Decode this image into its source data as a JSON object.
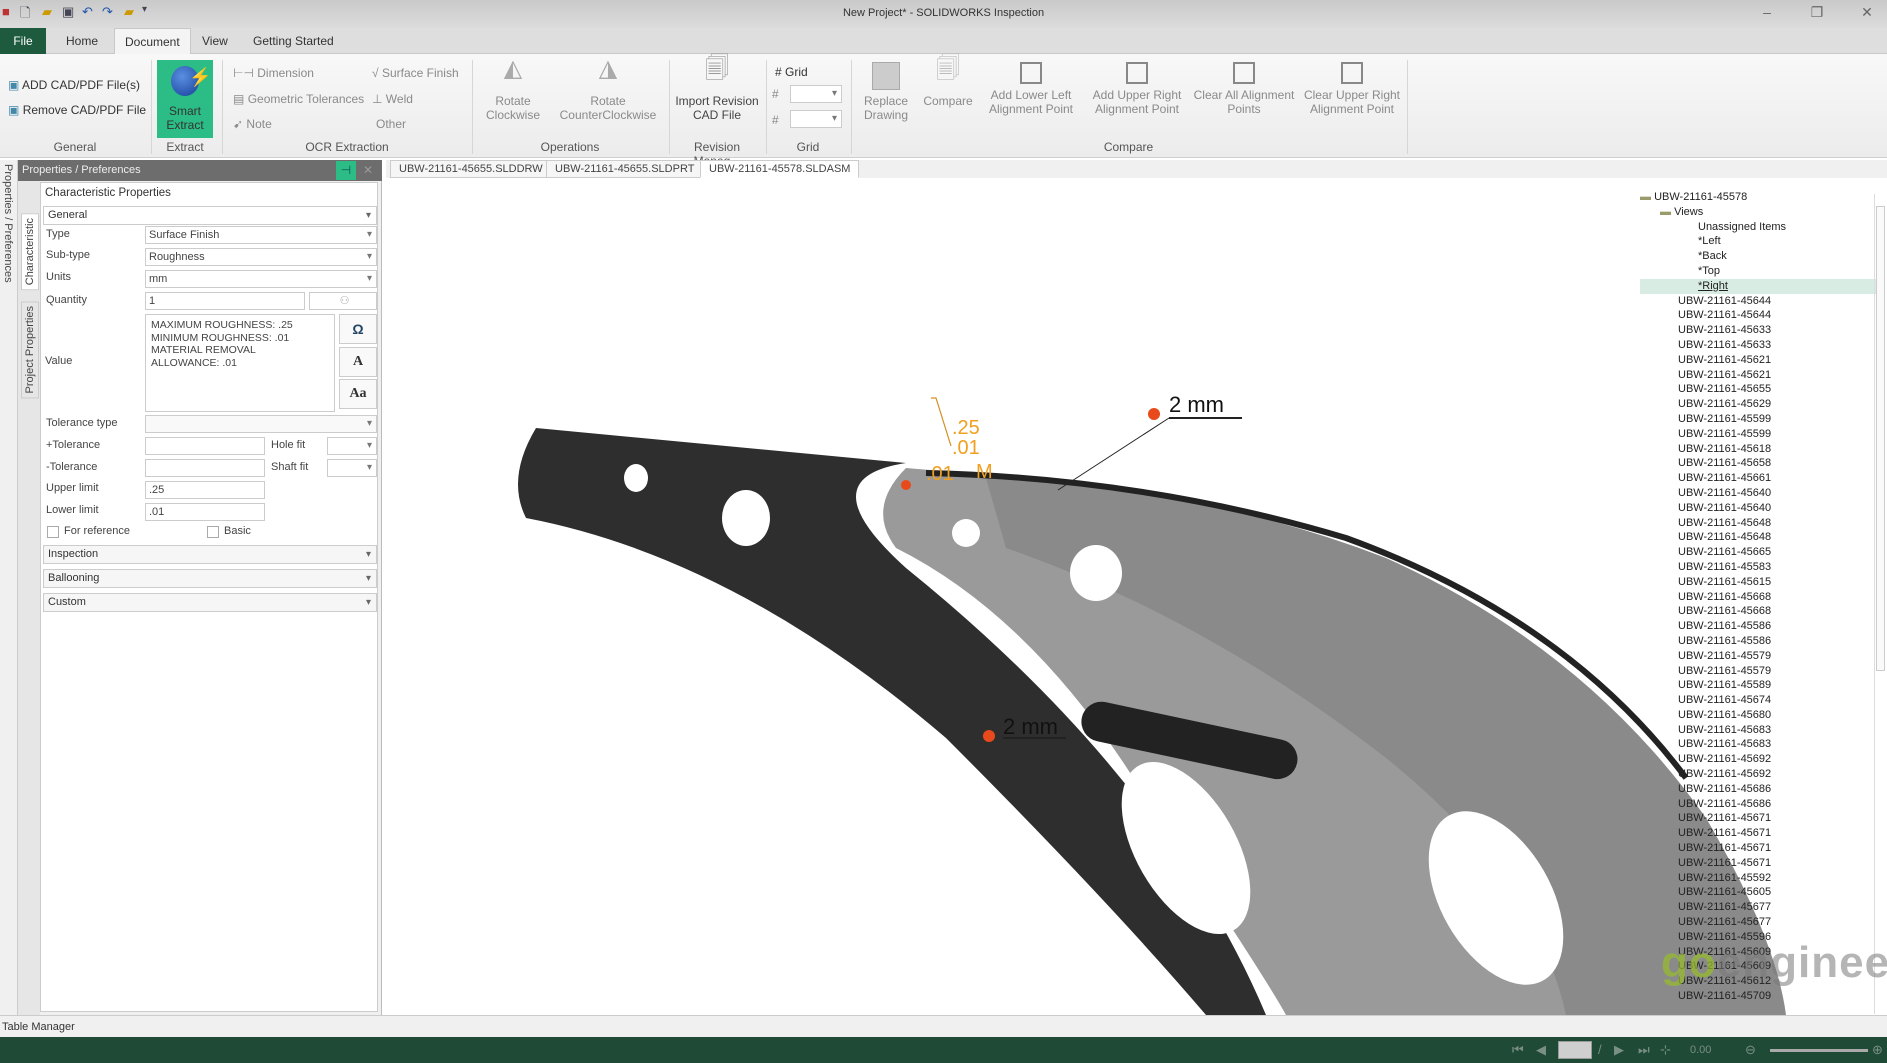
{
  "window": {
    "title": "New Project* - SOLIDWORKS Inspection"
  },
  "menu_tabs": [
    "File",
    "Home",
    "Document",
    "View",
    "Getting Started"
  ],
  "ribbon": {
    "general": {
      "label": "General",
      "add": "ADD CAD/PDF File(s)",
      "remove": "Remove CAD/PDF File"
    },
    "extract": {
      "label": "Extract",
      "smart": "Smart Extract"
    },
    "ocr": {
      "label": "OCR Extraction",
      "dimension": "Dimension",
      "gtol": "Geometric Tolerances",
      "note": "Note",
      "surface": "Surface Finish",
      "weld": "Weld",
      "other": "Other"
    },
    "operations": {
      "label": "Operations",
      "rotate_cw": "Rotate Clockwise",
      "rotate_ccw": "Rotate CounterClockwise"
    },
    "revision": {
      "label": "Revision Manag...",
      "import": "Import Revision CAD File"
    },
    "grid": {
      "label": "Grid",
      "grid": "Grid"
    },
    "compare": {
      "label": "Compare",
      "replace": "Replace Drawing",
      "compare": "Compare",
      "add_ll": "Add Lower Left Alignment Point",
      "add_ur": "Add Upper Right Alignment Point",
      "clear_all": "Clear All Alignment Points",
      "clear_ur": "Clear Upper Right Alignment Point"
    }
  },
  "side_strip": {
    "label": "Properties / Preferences"
  },
  "panel": {
    "title": "Properties / Preferences",
    "vtabs": [
      "Characteristic",
      "Project Properties"
    ],
    "heading": "Characteristic Properties",
    "general": "General",
    "type": {
      "label": "Type",
      "value": "Surface Finish"
    },
    "subtype": {
      "label": "Sub-type",
      "value": "Roughness"
    },
    "units": {
      "label": "Units",
      "value": "mm"
    },
    "quantity": {
      "label": "Quantity",
      "value": "1"
    },
    "value": {
      "label": "Value",
      "lines": [
        "MAXIMUM ROUGHNESS: .25",
        "MINIMUM ROUGHNESS: .01",
        "MATERIAL REMOVAL",
        "ALLOWANCE: .01"
      ]
    },
    "tolerance_type": {
      "label": "Tolerance type",
      "value": ""
    },
    "plus_tol": {
      "label": "+Tolerance",
      "value": ""
    },
    "minus_tol": {
      "label": "-Tolerance",
      "value": ""
    },
    "hole_fit": {
      "label": "Hole fit",
      "value": ""
    },
    "shaft_fit": {
      "label": "Shaft fit",
      "value": ""
    },
    "upper": {
      "label": "Upper limit",
      "value": ".25"
    },
    "lower": {
      "label": "Lower limit",
      "value": ".01"
    },
    "for_reference": {
      "label": "For reference",
      "checked": false
    },
    "basic": {
      "label": "Basic",
      "checked": false
    },
    "sections": [
      "Inspection",
      "Ballooning",
      "Custom"
    ]
  },
  "doc_tabs": [
    {
      "label": "UBW-21161-45655.SLDDRW"
    },
    {
      "label": "UBW-21161-45655.SLDPRT"
    },
    {
      "label": "UBW-21161-45578.SLDASM",
      "active": true
    }
  ],
  "annotations": {
    "surface": [
      ".25",
      ".01",
      ".01",
      "M"
    ],
    "dim1": "2 mm",
    "dim2": "2 mm"
  },
  "tree": {
    "root": "UBW-21161-45578",
    "views": "Views",
    "view_items": [
      "Unassigned Items",
      "*Left",
      "*Back",
      "*Top",
      "*Right"
    ],
    "selected": "*Right",
    "parts": [
      "UBW-21161-45644",
      "UBW-21161-45644",
      "UBW-21161-45633",
      "UBW-21161-45633",
      "UBW-21161-45621",
      "UBW-21161-45621",
      "UBW-21161-45655",
      "UBW-21161-45629",
      "UBW-21161-45599",
      "UBW-21161-45599",
      "UBW-21161-45618",
      "UBW-21161-45658",
      "UBW-21161-45661",
      "UBW-21161-45640",
      "UBW-21161-45640",
      "UBW-21161-45648",
      "UBW-21161-45648",
      "UBW-21161-45665",
      "UBW-21161-45583",
      "UBW-21161-45615",
      "UBW-21161-45668",
      "UBW-21161-45668",
      "UBW-21161-45586",
      "UBW-21161-45586",
      "UBW-21161-45579",
      "UBW-21161-45579",
      "UBW-21161-45589",
      "UBW-21161-45674",
      "UBW-21161-45680",
      "UBW-21161-45683",
      "UBW-21161-45683",
      "UBW-21161-45692",
      "UBW-21161-45692",
      "UBW-21161-45686",
      "UBW-21161-45686",
      "UBW-21161-45671",
      "UBW-21161-45671",
      "UBW-21161-45671",
      "UBW-21161-45671",
      "UBW-21161-45592",
      "UBW-21161-45605",
      "UBW-21161-45677",
      "UBW-21161-45677",
      "UBW-21161-45596",
      "UBW-21161-45609",
      "UBW-21161-45609",
      "UBW-21161-45612",
      "UBW-21161-45709"
    ]
  },
  "status": {
    "text": "Table Manager",
    "zoom": "0.00"
  },
  "watermark": "goengineer",
  "colors": {
    "accent": "#2bbd85",
    "file_tab": "#1d5a3e",
    "bottom_bar": "#1e4a36",
    "annotation": "#f0a020",
    "balloon": "#e84a1c"
  }
}
